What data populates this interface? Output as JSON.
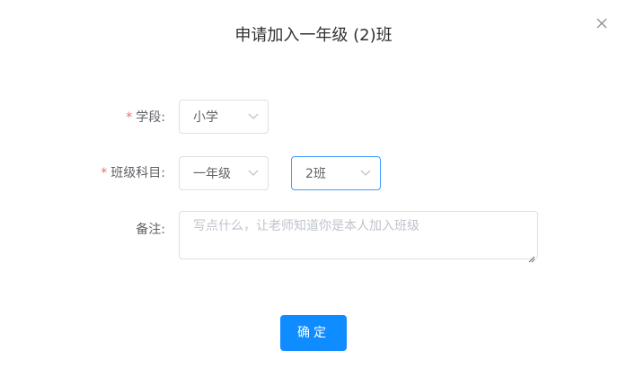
{
  "dialog": {
    "title": "申请加入一年级 (2)班",
    "close_icon": "close-icon"
  },
  "form": {
    "required_mark": "*",
    "stage": {
      "label": "学段:",
      "value": "小学"
    },
    "class_subject": {
      "label": "班级科目:",
      "grade_value": "一年级",
      "class_value": "2班"
    },
    "remark": {
      "label": "备注:",
      "placeholder": "写点什么，让老师知道你是本人加入班级"
    }
  },
  "actions": {
    "confirm_label": "确定"
  },
  "colors": {
    "primary": "#0f8cff",
    "required": "#f56c6c",
    "focus_border": "#409eff"
  }
}
